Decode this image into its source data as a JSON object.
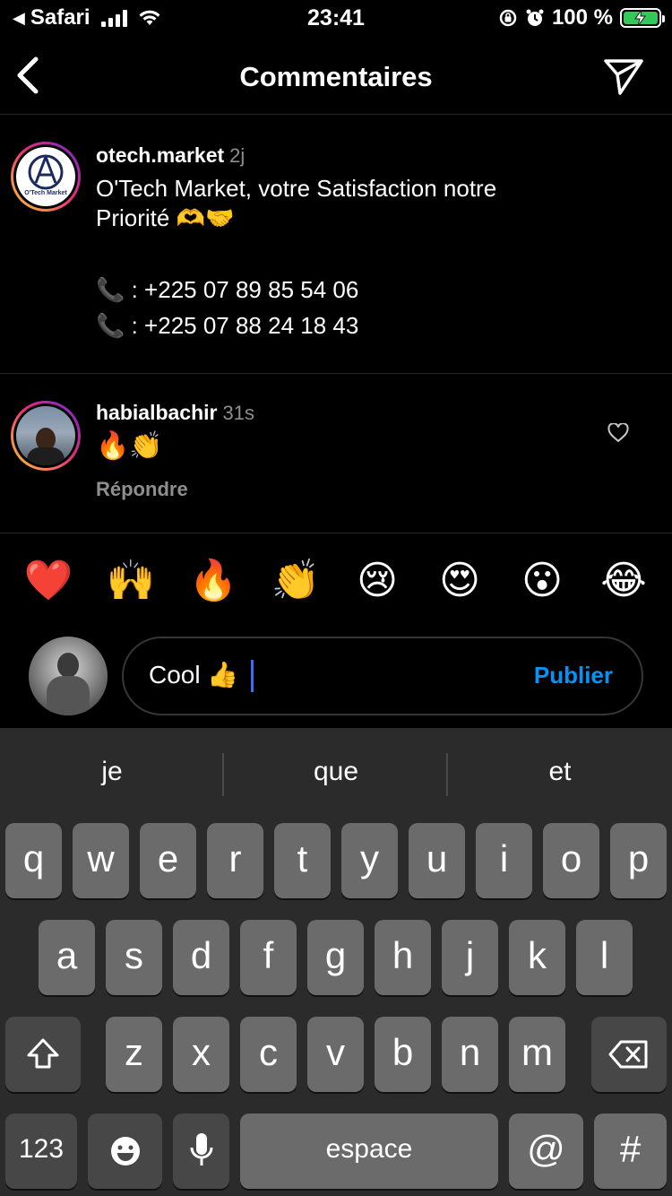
{
  "status_bar": {
    "back_app": "Safari",
    "time": "23:41",
    "battery": "100 %"
  },
  "header": {
    "title": "Commentaires"
  },
  "post": {
    "username": "otech.market",
    "time": "2j",
    "caption_line1": "O'Tech Market, votre Satisfaction notre",
    "caption_line2": "Priorité 🫶🤝",
    "phone1": "📞 : +225 07 89 85 54 06",
    "phone2": "📞 : +225 07 88 24 18 43",
    "avatar_text": "O'Tech Market"
  },
  "comment": {
    "username": "habialbachir",
    "time": "31s",
    "text": "🔥👏",
    "reply_label": "Répondre"
  },
  "quick_reactions": [
    "❤️",
    "🙌",
    "🔥",
    "👏",
    "😢",
    "😍",
    "😮",
    "😂"
  ],
  "compose": {
    "value": "Cool 👍",
    "publish_label": "Publier"
  },
  "keyboard": {
    "suggestions": [
      "je",
      "que",
      "et"
    ],
    "row1": [
      "q",
      "w",
      "e",
      "r",
      "t",
      "y",
      "u",
      "i",
      "o",
      "p"
    ],
    "row2": [
      "a",
      "s",
      "d",
      "f",
      "g",
      "h",
      "j",
      "k",
      "l"
    ],
    "row3": [
      "z",
      "x",
      "c",
      "v",
      "b",
      "n",
      "m"
    ],
    "numbers_label": "123",
    "space_label": "espace",
    "at_label": "@",
    "hash_label": "#"
  },
  "colors": {
    "accent": "#0095f6",
    "battery": "#34c759",
    "ring_start": "#f9ce34",
    "ring_end": "#6228d7"
  }
}
